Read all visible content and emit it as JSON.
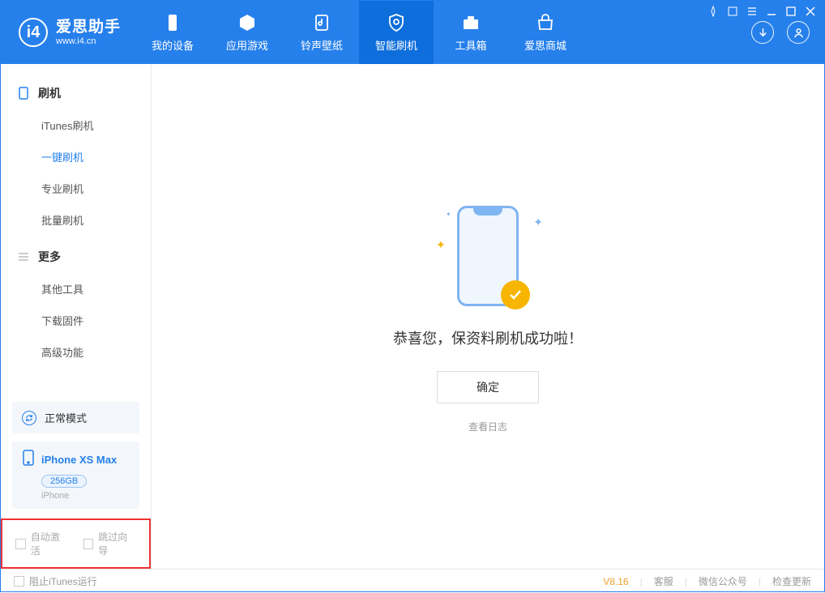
{
  "header": {
    "logo_main": "爱思助手",
    "logo_sub": "www.i4.cn",
    "tabs": [
      {
        "label": "我的设备"
      },
      {
        "label": "应用游戏"
      },
      {
        "label": "铃声壁纸"
      },
      {
        "label": "智能刷机"
      },
      {
        "label": "工具箱"
      },
      {
        "label": "爱思商城"
      }
    ]
  },
  "sidebar": {
    "section1": {
      "title": "刷机",
      "items": [
        "iTunes刷机",
        "一键刷机",
        "专业刷机",
        "批量刷机"
      ]
    },
    "section2": {
      "title": "更多",
      "items": [
        "其他工具",
        "下载固件",
        "高级功能"
      ]
    },
    "mode_label": "正常模式",
    "device": {
      "name": "iPhone XS Max",
      "capacity": "256GB",
      "sub": "iPhone"
    },
    "chk1": "自动激活",
    "chk2": "跳过向导"
  },
  "main": {
    "success_msg": "恭喜您，保资料刷机成功啦！",
    "ok_label": "确定",
    "log_link": "查看日志"
  },
  "footer": {
    "block_itunes": "阻止iTunes运行",
    "version": "V8.16",
    "support": "客服",
    "wechat": "微信公众号",
    "check_update": "检查更新"
  }
}
